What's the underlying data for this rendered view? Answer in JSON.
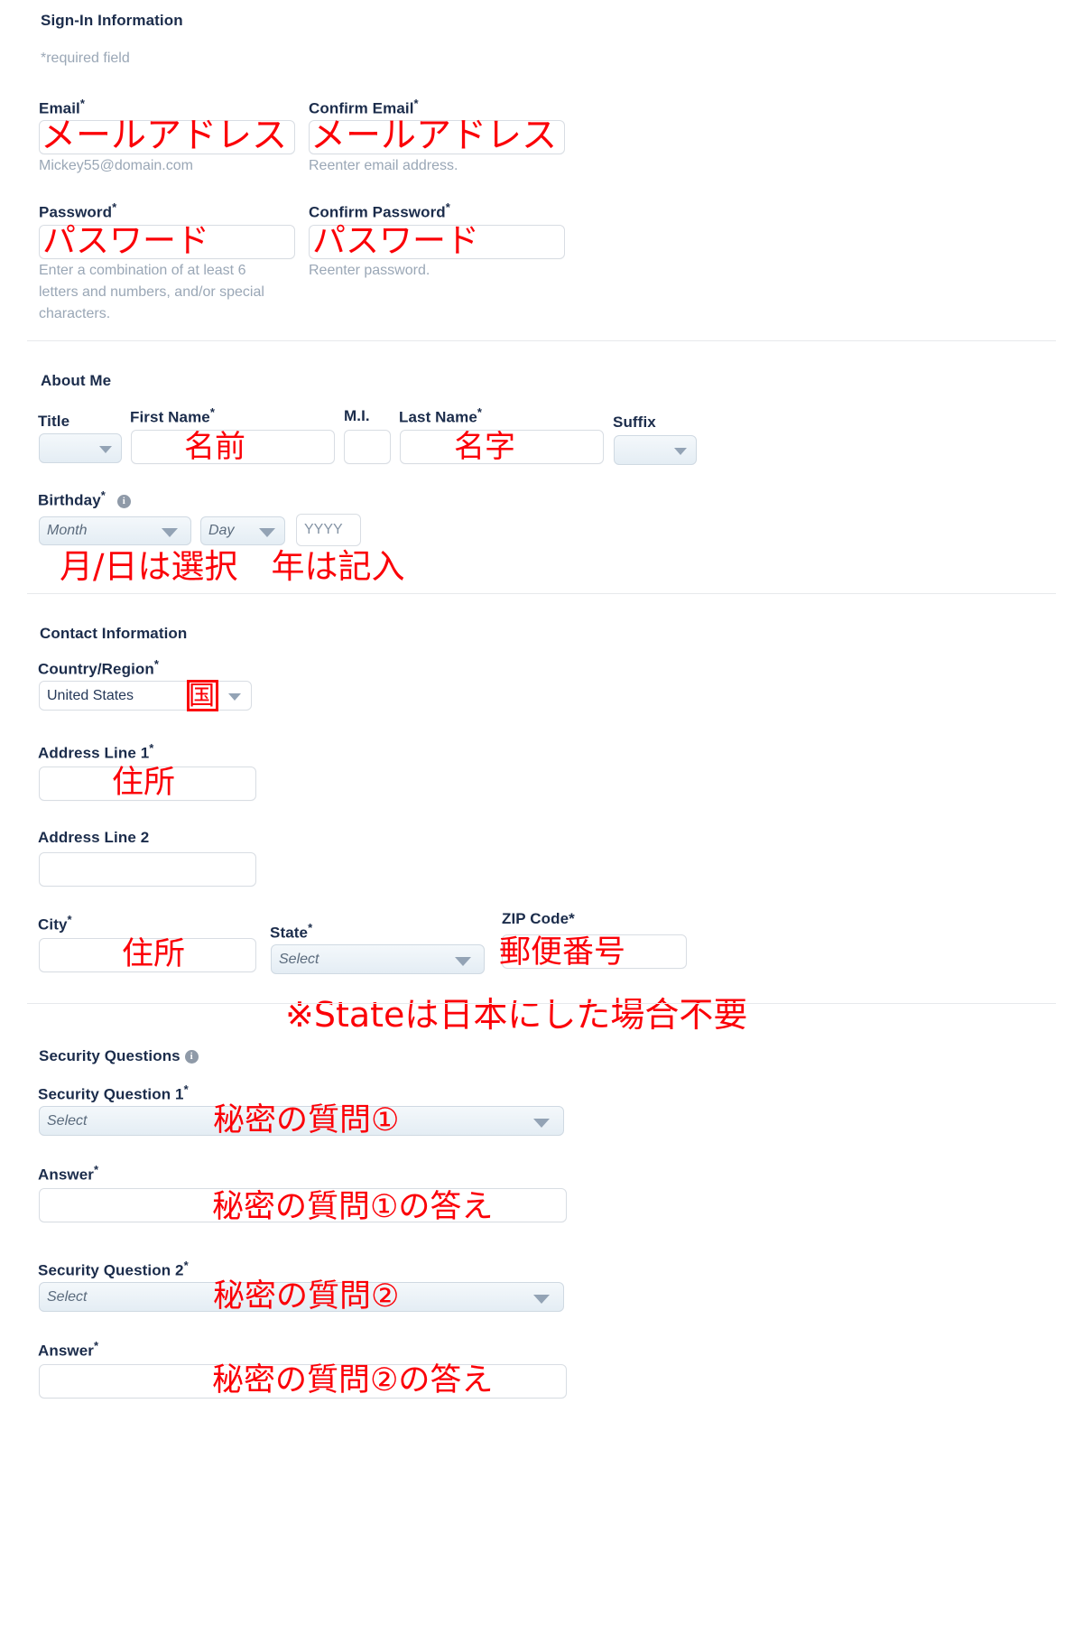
{
  "signin": {
    "title": "Sign-In Information",
    "required_note": "*required field",
    "email": {
      "label": "Email",
      "required": "*",
      "hint": "Mickey55@domain.com",
      "annotation": "メールアドレス"
    },
    "confirm_email": {
      "label": "Confirm Email",
      "required": "*",
      "hint": "Reenter email address.",
      "annotation": "メールアドレス"
    },
    "password": {
      "label": "Password",
      "required": "*",
      "hint": "Enter a combination of at least 6 letters and numbers, and/or special characters.",
      "annotation": "パスワード"
    },
    "confirm_password": {
      "label": "Confirm Password",
      "required": "*",
      "hint": "Reenter password.",
      "annotation": "パスワード"
    }
  },
  "about": {
    "title": "About Me",
    "title_field": {
      "label": "Title",
      "value": ""
    },
    "first_name": {
      "label": "First Name",
      "required": "*",
      "annotation": "名前"
    },
    "mi": {
      "label": "M.I."
    },
    "last_name": {
      "label": "Last Name",
      "required": "*",
      "annotation": "名字"
    },
    "suffix": {
      "label": "Suffix",
      "value": ""
    },
    "birthday": {
      "label": "Birthday",
      "required": "*",
      "info_icon": "info-icon",
      "month_placeholder": "Month",
      "day_placeholder": "Day",
      "year_placeholder": "YYYY",
      "annotation": "月/日は選択　年は記入"
    }
  },
  "contact": {
    "title": "Contact Information",
    "country": {
      "label": "Country/Region",
      "required": "*",
      "value": "United States",
      "annotation": "国"
    },
    "address1": {
      "label": "Address Line 1",
      "required": "*",
      "annotation": "住所"
    },
    "address2": {
      "label": "Address Line 2",
      "value": ""
    },
    "city": {
      "label": "City",
      "required": "*",
      "annotation": "住所"
    },
    "state": {
      "label": "State",
      "required": "*",
      "placeholder": "Select"
    },
    "zip": {
      "label": "ZIP Code*",
      "annotation": "郵便番号"
    },
    "state_note": "※Stateは日本にした場合不要"
  },
  "security": {
    "title": "Security Questions",
    "info_icon": "info-icon",
    "question1": {
      "label": "Security Question 1",
      "required": "*",
      "placeholder": "Select",
      "annotation": "秘密の質問①"
    },
    "answer1": {
      "label": "Answer",
      "required": "*",
      "annotation": "秘密の質問①の答え"
    },
    "question2": {
      "label": "Security Question 2",
      "required": "*",
      "placeholder": "Select",
      "annotation": "秘密の質問②"
    },
    "answer2": {
      "label": "Answer",
      "required": "*",
      "annotation": "秘密の質問②の答え"
    }
  },
  "colors": {
    "annotation_red": "#fb0007",
    "label_navy": "#1b2c4b",
    "hint_gray": "#9aa7b6"
  }
}
